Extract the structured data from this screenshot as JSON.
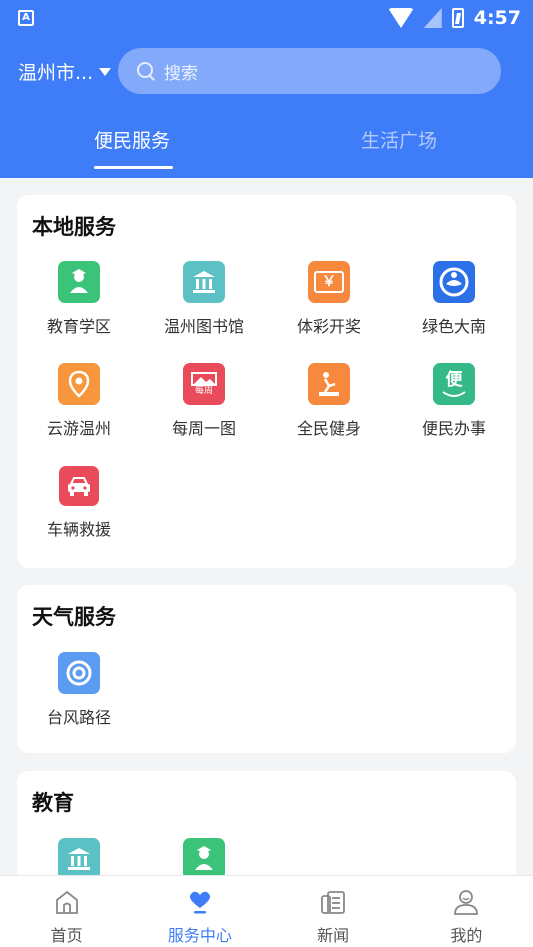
{
  "status_bar": {
    "time": "4:57",
    "app_badge": "A"
  },
  "header": {
    "city": "温州市...",
    "search_placeholder": "搜索",
    "tabs": [
      {
        "label": "便民服务",
        "active": true
      },
      {
        "label": "生活广场",
        "active": false
      }
    ]
  },
  "sections": [
    {
      "title": "本地服务",
      "items": [
        {
          "label": "教育学区",
          "icon": "education-icon",
          "color": "#3cc37a"
        },
        {
          "label": "温州图书馆",
          "icon": "library-icon",
          "color": "#5cc1c5"
        },
        {
          "label": "体彩开奖",
          "icon": "lottery-icon",
          "color": "#f7893e"
        },
        {
          "label": "绿色大南",
          "icon": "dongnan-logo-icon",
          "color": "#2b70e6"
        },
        {
          "label": "云游温州",
          "icon": "location-pin-icon",
          "color": "#f7963d"
        },
        {
          "label": "每周一图",
          "icon": "weekly-picture-icon",
          "color": "#e94b5b"
        },
        {
          "label": "全民健身",
          "icon": "fitness-icon",
          "color": "#f7893e"
        },
        {
          "label": "便民办事",
          "icon": "convenience-icon",
          "color": "#35b988"
        },
        {
          "label": "车辆救援",
          "icon": "car-rescue-icon",
          "color": "#e94b5b"
        }
      ]
    },
    {
      "title": "天气服务",
      "items": [
        {
          "label": "台风路径",
          "icon": "typhoon-icon",
          "color": "#5b9bf2"
        }
      ]
    },
    {
      "title": "教育",
      "items": [
        {
          "label": "",
          "icon": "library-icon",
          "color": "#5cc1c5"
        },
        {
          "label": "",
          "icon": "education-icon",
          "color": "#3cc37a"
        }
      ]
    }
  ],
  "icon_glyphs": {
    "lottery": "￥",
    "weekly": "每周",
    "convenience": "便"
  },
  "bottom_nav": [
    {
      "label": "首页",
      "icon": "home-icon",
      "active": false
    },
    {
      "label": "服务中心",
      "icon": "service-heart-icon",
      "active": true
    },
    {
      "label": "新闻",
      "icon": "news-icon",
      "active": false
    },
    {
      "label": "我的",
      "icon": "profile-icon",
      "active": false
    }
  ],
  "colors": {
    "primary": "#3f7cf8",
    "background": "#f3f4f6"
  }
}
